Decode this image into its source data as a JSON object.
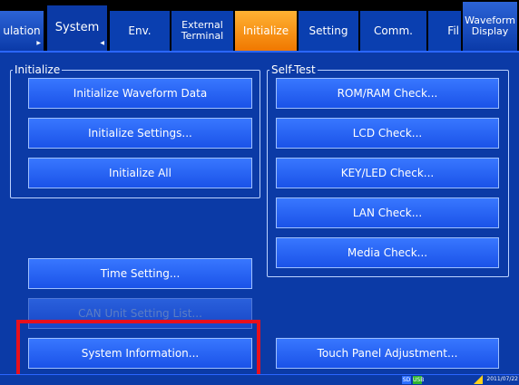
{
  "tabs": [
    {
      "label": "ulation"
    },
    {
      "label": "System"
    },
    {
      "label": "Env."
    },
    {
      "label": "External\nTerminal"
    },
    {
      "label": "Initialize"
    },
    {
      "label": "Setting"
    },
    {
      "label": "Comm."
    },
    {
      "label": "Fil"
    },
    {
      "label": "Waveform\nDisplay"
    }
  ],
  "initialize_group": {
    "title": "Initialize",
    "buttons": [
      "Initialize Waveform Data",
      "Initialize Settings...",
      "Initialize All"
    ]
  },
  "selftest_group": {
    "title": "Self-Test",
    "buttons": [
      "ROM/RAM Check...",
      "LCD Check...",
      "KEY/LED Check...",
      "LAN Check...",
      "Media Check..."
    ]
  },
  "time_setting": "Time Setting...",
  "can_unit_list": "CAN Unit Setting List...",
  "system_information": "System Information...",
  "touch_panel": "Touch Panel Adjustment...",
  "status": {
    "sd": "SD",
    "usb": "USB",
    "date": "2011/07/22"
  },
  "colors": {
    "panel": "#0b3aa6",
    "button": "#1f5cf0",
    "active_tab_orange": "#f58a0a",
    "highlight": "#e8101c"
  }
}
